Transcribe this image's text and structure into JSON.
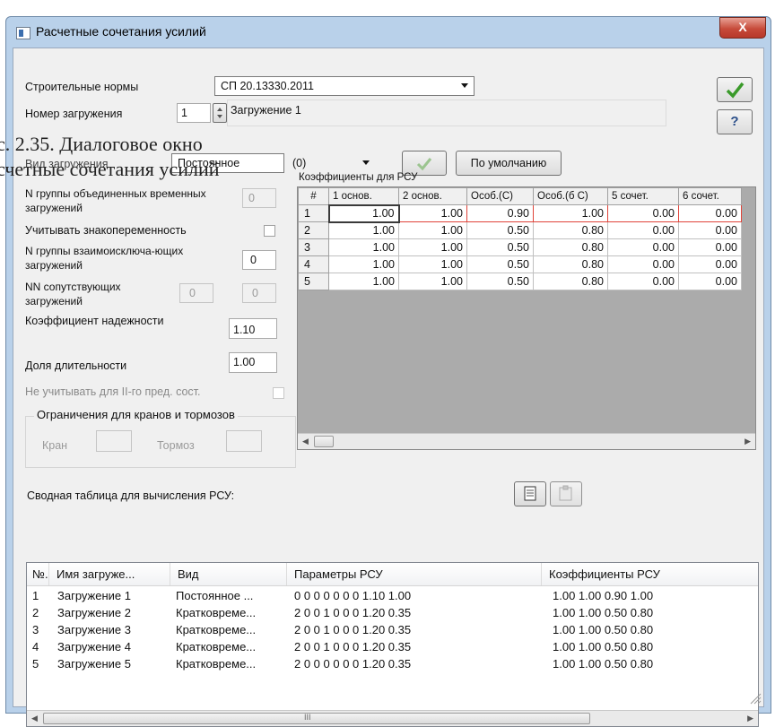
{
  "window": {
    "title": "Расчетные сочетания усилий",
    "close_label": "X"
  },
  "caption": {
    "line1": "с. 2.35. Диалоговое окно",
    "line2": "счетные сочетания усилий"
  },
  "norms": {
    "label": "Строительные нормы",
    "value": "СП 20.13330.2011"
  },
  "load_number": {
    "label": "Номер загружения",
    "value": "1",
    "name": "Загружение 1"
  },
  "load_type": {
    "label": "Вид загружения",
    "value": "Постоянное",
    "group_value": "(0)",
    "default_button": "По умолчанию"
  },
  "side_buttons": {
    "ok": "ok-check",
    "help": "?"
  },
  "left_panel": {
    "groups_label": "N группы объединенных временных загружений",
    "groups_value": "0",
    "sign_label": "Учитывать знакопеременность",
    "mutex_label": "N группы взаимоисключа-ющих загружений",
    "mutex_value": "0",
    "accomp_label": "NN сопутствующих загружений",
    "accomp_value1": "0",
    "accomp_value2": "0",
    "reliability_label": "Коэффициент надежности",
    "reliability_value": "1.10",
    "duration_label": "Доля длительности",
    "duration_value": "1.00",
    "ignore_label": "Не учитывать для II-го пред. сост.",
    "crane_group": "Ограничения для кранов и тормозов",
    "crane_label": "Кран",
    "brake_label": "Тормоз"
  },
  "coef_grid": {
    "title": "Коэффициенты для РСУ",
    "headers": [
      "#",
      "1 основ.",
      "2 основ.",
      "Особ.(С)",
      "Особ.(б С)",
      "5 сочет.",
      "6 сочет."
    ],
    "rows": [
      [
        "1",
        "1.00",
        "1.00",
        "0.90",
        "1.00",
        "0.00",
        "0.00"
      ],
      [
        "2",
        "1.00",
        "1.00",
        "0.50",
        "0.80",
        "0.00",
        "0.00"
      ],
      [
        "3",
        "1.00",
        "1.00",
        "0.50",
        "0.80",
        "0.00",
        "0.00"
      ],
      [
        "4",
        "1.00",
        "1.00",
        "0.50",
        "0.80",
        "0.00",
        "0.00"
      ],
      [
        "5",
        "1.00",
        "1.00",
        "0.50",
        "0.80",
        "0.00",
        "0.00"
      ]
    ]
  },
  "summary": {
    "label": "Сводная таблица для вычисления РСУ:",
    "headers": [
      "№.",
      "Имя загруже...",
      "Вид",
      "Параметры РСУ",
      "Коэффициенты РСУ"
    ],
    "rows": [
      [
        "1",
        "Загружение 1",
        "Постоянное ...",
        "0 0 0 0 0 0 0 1.10 1.00",
        "1.00 1.00 0.90 1.00"
      ],
      [
        "2",
        "Загружение 2",
        "Кратковреме...",
        "2 0 0 1 0 0 0 1.20 0.35",
        "1.00 1.00 0.50 0.80"
      ],
      [
        "3",
        "Загружение 3",
        "Кратковреме...",
        "2 0 0 1 0 0 0 1.20 0.35",
        "1.00 1.00 0.50 0.80"
      ],
      [
        "4",
        "Загружение 4",
        "Кратковреме...",
        "2 0 0 1 0 0 0 1.20 0.35",
        "1.00 1.00 0.50 0.80"
      ],
      [
        "5",
        "Загружение 5",
        "Кратковреме...",
        "2 0 0 0 0 0 0 1.20 0.35",
        "1.00 1.00 0.50 0.80"
      ]
    ],
    "scroll_mark": "III"
  },
  "colors": {
    "accent_red": "#e0443a",
    "check_green": "#3a9a2a"
  }
}
